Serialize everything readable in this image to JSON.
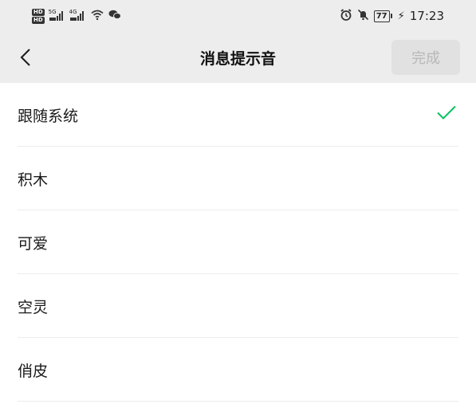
{
  "status_bar": {
    "hd1": "HD",
    "hd2": "HD",
    "signal1_label": "5G",
    "signal2_label": "4G",
    "battery_level": "77",
    "time": "17:23",
    "icons": [
      "signal-icon",
      "wifi-icon",
      "wechat-icon",
      "alarm-icon",
      "mute-icon",
      "battery-icon",
      "charging-icon"
    ]
  },
  "header": {
    "title": "消息提示音",
    "done_label": "完成",
    "back_icon": "chevron-left-icon"
  },
  "sounds": [
    {
      "label": "跟随系统",
      "selected": true
    },
    {
      "label": "积木",
      "selected": false
    },
    {
      "label": "可爱",
      "selected": false
    },
    {
      "label": "空灵",
      "selected": false
    },
    {
      "label": "俏皮",
      "selected": false
    }
  ],
  "colors": {
    "accent": "#07c160",
    "header_bg": "#ededed",
    "done_bg": "#e1e1e1",
    "done_text": "#b8b8b8"
  }
}
